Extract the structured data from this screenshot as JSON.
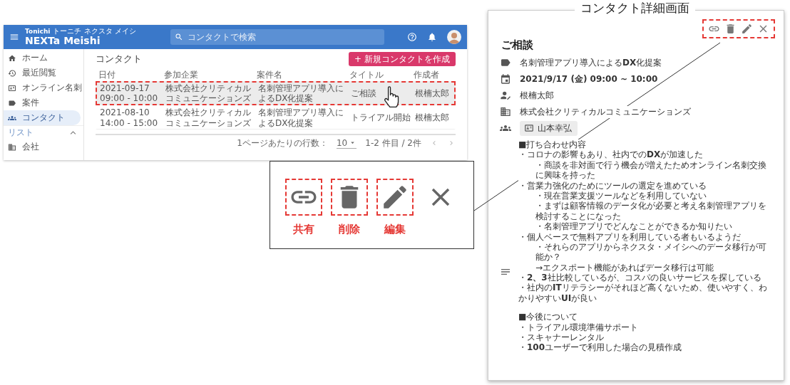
{
  "app": {
    "logo_top": "Tonichi",
    "logo_sub": "トーニチ ネクスタ メイシ",
    "logo": "NEXTa Meishi",
    "search": {
      "placeholder": "コンタクトで検索"
    },
    "sidebar": {
      "items": [
        {
          "label": "ホーム",
          "selected": false
        },
        {
          "label": "最近閲覧",
          "selected": false
        },
        {
          "label": "オンライン名刺",
          "selected": false
        },
        {
          "label": "案件",
          "selected": false
        },
        {
          "label": "コンタクト",
          "selected": true
        }
      ],
      "section": {
        "label": "リスト",
        "expanded": true
      },
      "section_items": [
        {
          "label": "会社",
          "selected": false
        }
      ]
    },
    "page_title": "コンタクト",
    "create_button": {
      "icon": "+",
      "label": "新規コンタクトを作成"
    },
    "table": {
      "columns": [
        "日付",
        "参加企業",
        "案件名",
        "タイトル",
        "作成者"
      ],
      "rows": [
        {
          "date": "2021-09-17",
          "time": "09:00 - 10:00",
          "company": "株式会社クリティカルコミュニケーションズ",
          "project": "名刺管理アプリ導入によるDX化提案",
          "title": "ご相談",
          "author": "根楠太郎",
          "selected": true
        },
        {
          "date": "2021-08-10",
          "time": "14:00 - 15:00",
          "company": "株式会社クリティカルコミュニケーションズ",
          "project": "名刺管理アプリ導入によるDX化提案",
          "title": "トライアル開始",
          "author": "根楠太郎",
          "selected": false
        }
      ]
    },
    "pagination": {
      "rows_label": "1ページあたりの行数：",
      "rows_value": "10",
      "range": "1-2 件目 / 2件"
    }
  },
  "callout": {
    "actions": [
      {
        "kind": "link",
        "label": "共有"
      },
      {
        "kind": "delete",
        "label": "削除"
      },
      {
        "kind": "edit",
        "label": "編集"
      },
      {
        "kind": "close"
      }
    ]
  },
  "detail": {
    "caption": "コンタクト詳細画面",
    "actions": [
      {
        "kind": "link"
      },
      {
        "kind": "delete"
      },
      {
        "kind": "edit"
      },
      {
        "kind": "close"
      }
    ],
    "title": "ご相談",
    "project": "名刺管理アプリ導入による**DX**化提案",
    "datetime": "2021/9/17 (金) 09:00 ~ 10:00",
    "owner": "根楠太郎",
    "company": "株式会社クリティカルコミュニケーションズ",
    "participants": [
      {
        "name": "山本幸弘"
      }
    ],
    "sections": [
      {
        "heading": "■打ち合わせ内容",
        "items": [
          {
            "text": "・コロナの影響もあり、社内での**DX**が加速した",
            "children": [
              {
                "text": "・商談を非対面で行う機会が増えたためオンライン名刺交換に興味を持った"
              }
            ]
          },
          {
            "text": "・営業力強化のためにツールの選定を進めている",
            "children": [
              {
                "text": "・現在営業支援ツールなどを利用していない"
              },
              {
                "text": "・まずは顧客情報のデータ化が必要と考え名刺管理アプリを検討することになった"
              },
              {
                "text": "・名刺管理アプリでどんなことができるか知りたい"
              }
            ]
          },
          {
            "text": "・個人ベースで無料アプリを利用している者もいるようだ",
            "children": [
              {
                "text": "・それらのアプリからネクスタ・メイシへのデータ移行が可能か？"
              },
              {
                "text": "→エクスポート機能があればデータ移行は可能"
              }
            ]
          },
          {
            "text": "・**2、3**社比較しているが、コスパの良いサービスを探している"
          },
          {
            "text": "・社内の**IT**リテラシーがそれほど高くないため、使いやすく、わかりやすい**UI**が良い"
          }
        ]
      },
      {
        "heading": "■今後について",
        "items": [
          {
            "text": "・トライアル環境準備サポート"
          },
          {
            "text": "・スキャナーレンタル"
          },
          {
            "text": "・**100**ユーザーで利用した場合の見積作成"
          }
        ]
      }
    ]
  }
}
